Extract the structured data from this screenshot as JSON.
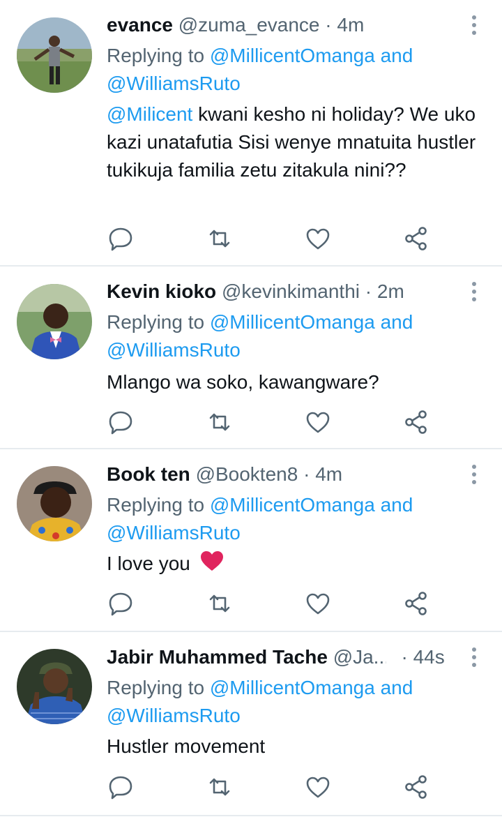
{
  "tweets": [
    {
      "name": "evance",
      "handle": "@zuma_evance",
      "dot": "·",
      "time": "4m",
      "replying_prefix": "Replying to",
      "reply_to_1": "@MillicentOmanga",
      "reply_and": "and",
      "reply_to_2": "@WilliamsRuto",
      "mention": "@Milicent",
      "text": " kwani kesho ni holiday? We uko kazi unatafutia Sisi wenye mnatuita hustler tukikuja familia zetu zitakula nini??"
    },
    {
      "name": "Kevin kioko",
      "handle": "@kevinkimanthi",
      "dot": "·",
      "time": "2m",
      "replying_prefix": "Replying to",
      "reply_to_1": "@MillicentOmanga",
      "reply_and": "and",
      "reply_to_2": "@WilliamsRuto",
      "text": "Mlango wa soko, kawangware?"
    },
    {
      "name": "Book ten",
      "handle": "@Bookten8",
      "dot": "·",
      "time": "4m",
      "replying_prefix": "Replying to",
      "reply_to_1": "@MillicentOmanga",
      "reply_and": "and",
      "reply_to_2": "@WilliamsRuto",
      "text": "I love you",
      "emoji": "red-heart"
    },
    {
      "name": "Jabir Muhammed Tache",
      "handle": "@Ja...",
      "dot": "·",
      "time": "44s",
      "replying_prefix": "Replying to",
      "reply_to_1": "@MillicentOmanga",
      "reply_and": "and",
      "reply_to_2": "@WilliamsRuto",
      "text": "Hustler movement"
    }
  ],
  "icons": {
    "reply": "reply-icon",
    "retweet": "retweet-icon",
    "like": "like-icon",
    "share": "share-icon",
    "more": "more-options-icon"
  },
  "colors": {
    "link": "#1d9bf0",
    "secondary_text": "#536471",
    "primary_text": "#0f1419",
    "divider": "#e6ebef",
    "heart_emoji": "#e0245e"
  }
}
